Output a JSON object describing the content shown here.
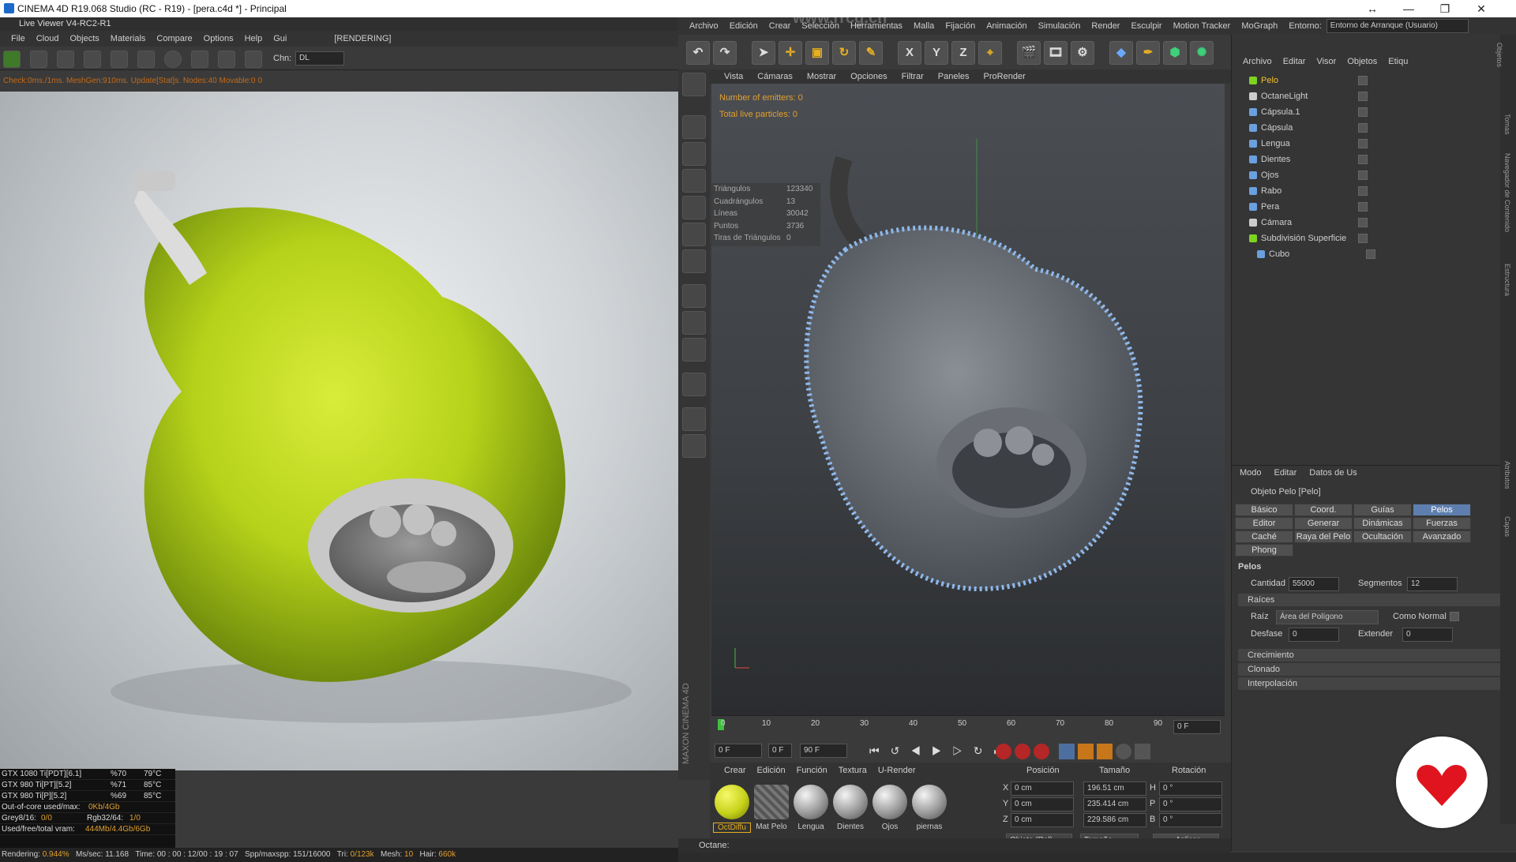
{
  "window": {
    "title": "CINEMA 4D R19.068 Studio (RC - R19) - [pera.c4d *] - Principal",
    "controls": [
      "↔",
      "—",
      "❐",
      "✕"
    ]
  },
  "live_viewer": {
    "title": "Live Viewer V4-RC2-R1",
    "menu": [
      "File",
      "Cloud",
      "Objects",
      "Materials",
      "Compare",
      "Options",
      "Help",
      "Gui"
    ],
    "state": "[RENDERING]",
    "chn_label": "Chn:",
    "chn_value": "DL",
    "status_line": "Check:0ms./1ms. MeshGen:910ms. Update[Stat]s. Nodes:40 Movable:0  0",
    "gpus": [
      {
        "name": "GTX 1080 Ti[PDT][6.1]",
        "pct": "%70",
        "temp": "79°C"
      },
      {
        "name": "GTX 980 Ti[PT][5.2]",
        "pct": "%71",
        "temp": "85°C"
      },
      {
        "name": "GTX 980 Ti[P][5.2]",
        "pct": "%69",
        "temp": "85°C"
      }
    ],
    "ooc_label": "Out-of-core used/max:",
    "ooc_value": "0Kb/4Gb",
    "grey_label": "Grey8/16:",
    "grey_value": "0/0",
    "rgb_label": "Rgb32/64:",
    "rgb_value": "1/0",
    "vram_label": "Used/free/total vram:",
    "vram_value": "444Mb/4.4Gb/6Gb",
    "bottom": {
      "rendering_label": "Rendering:",
      "rendering": "0.944%",
      "ms_label": "Ms/sec:",
      "ms": "11.168",
      "time_label": "Time:",
      "time": "00 : 00 : 12/00 : 19 : 07",
      "spp_label": "Spp/maxspp:",
      "spp": "151/16000",
      "tri_label": "Tri:",
      "tri": "0/123k",
      "mesh_label": "Mesh:",
      "mesh": "10",
      "hair_label": "Hair:",
      "hair": "660k"
    }
  },
  "main_menu": [
    "Archivo",
    "Edición",
    "Crear",
    "Selección",
    "Herramientas",
    "Malla",
    "Fijación",
    "Animación",
    "Simulación",
    "Render",
    "Esculpir",
    "Motion Tracker",
    "MoGraph",
    "Entorno:"
  ],
  "environment_value": "Entorno de Arranque (Usuario)",
  "viewport": {
    "menu": [
      "Vista",
      "Cámaras",
      "Mostrar",
      "Opciones",
      "Filtrar",
      "Paneles",
      "ProRender"
    ],
    "emitters": "Number of emitters: 0",
    "particles": "Total live particles: 0",
    "polyinfo": [
      {
        "k": "Triángulos",
        "v": "123340"
      },
      {
        "k": "Cuadrángulos",
        "v": "13"
      },
      {
        "k": "Líneas",
        "v": "30042"
      },
      {
        "k": "Puntos",
        "v": "3736"
      },
      {
        "k": "Tiras de Triángulos",
        "v": "0"
      }
    ]
  },
  "timeline": {
    "ticks": [
      "0",
      "10",
      "20",
      "30",
      "40",
      "50",
      "60",
      "70",
      "80",
      "90"
    ],
    "frame_end": "0 F",
    "cur": "0 F",
    "min": "0 F",
    "max": "90 F"
  },
  "materials": {
    "menu": [
      "Crear",
      "Edición",
      "Función",
      "Textura",
      "U-Render"
    ],
    "items": [
      "OctDiffu",
      "Mat Pelo",
      "Lengua",
      "Dientes",
      "Ojos",
      "piernas"
    ],
    "brand": "MAXON CINEMA 4D"
  },
  "coords": {
    "headers": [
      "Posición",
      "Tamaño",
      "Rotación"
    ],
    "rows": [
      {
        "a": "X",
        "p": "0 cm",
        "s": "196.51 cm",
        "r": "H",
        "rv": "0 °"
      },
      {
        "a": "Y",
        "p": "0 cm",
        "s": "235.414 cm",
        "r": "P",
        "rv": "0 °"
      },
      {
        "a": "Z",
        "p": "0 cm",
        "s": "229.586 cm",
        "r": "B",
        "rv": "0 °"
      }
    ],
    "mode": "Objeto (Rel)",
    "size": "Tamaño",
    "apply": "Aplicar"
  },
  "objects": {
    "menu": [
      "Archivo",
      "Editar",
      "Visor",
      "Objetos",
      "Etiqu"
    ],
    "items": [
      {
        "name": "Pelo",
        "color": "#7ed321",
        "sel": true
      },
      {
        "name": "OctaneLight",
        "color": "#cccccc"
      },
      {
        "name": "Cápsula.1",
        "color": "#6aa0e0"
      },
      {
        "name": "Cápsula",
        "color": "#6aa0e0"
      },
      {
        "name": "Lengua",
        "color": "#6aa0e0"
      },
      {
        "name": "Dientes",
        "color": "#6aa0e0"
      },
      {
        "name": "Ojos",
        "color": "#6aa0e0"
      },
      {
        "name": "Rabo",
        "color": "#6aa0e0"
      },
      {
        "name": "Pera",
        "color": "#6aa0e0"
      },
      {
        "name": "Cámara",
        "color": "#cccccc"
      },
      {
        "name": "Subdivisión Superficie",
        "color": "#7ed321"
      },
      {
        "name": "Cubo",
        "color": "#6aa0e0"
      }
    ]
  },
  "attributes": {
    "menu": [
      "Modo",
      "Editar",
      "Datos de Us"
    ],
    "object_title": "Objeto Pelo [Pelo]",
    "tabs": [
      [
        "Básico",
        "Coord.",
        "Guías",
        "Pelos"
      ],
      [
        "Editor",
        "Generar",
        "Dinámicas",
        "Fuerzas"
      ],
      [
        "Caché",
        "Raya del Pelo",
        "Ocultación",
        "Avanzado"
      ],
      [
        "Phong"
      ]
    ],
    "selected_tab": "Pelos",
    "section": "Pelos",
    "cantidad_label": "Cantidad",
    "cantidad": "55000",
    "segmentos_label": "Segmentos",
    "segmentos": "12",
    "raices": "Raíces",
    "raiz_label": "Raíz",
    "raiz_value": "Área del Polígono",
    "normal_label": "Como Normal",
    "desfase_label": "Desfase",
    "desfase": "0",
    "extender_label": "Extender",
    "extender": "0",
    "collapsed": [
      "Crecimiento",
      "Clonado",
      "Interpolación"
    ]
  },
  "status_bar": "Octane:",
  "side_tabs": [
    "Objetos",
    "Tomas",
    "Navegador de Contenido",
    "Estructura",
    "Atributos",
    "Capas"
  ],
  "watermark": "www.rrcg.cn"
}
